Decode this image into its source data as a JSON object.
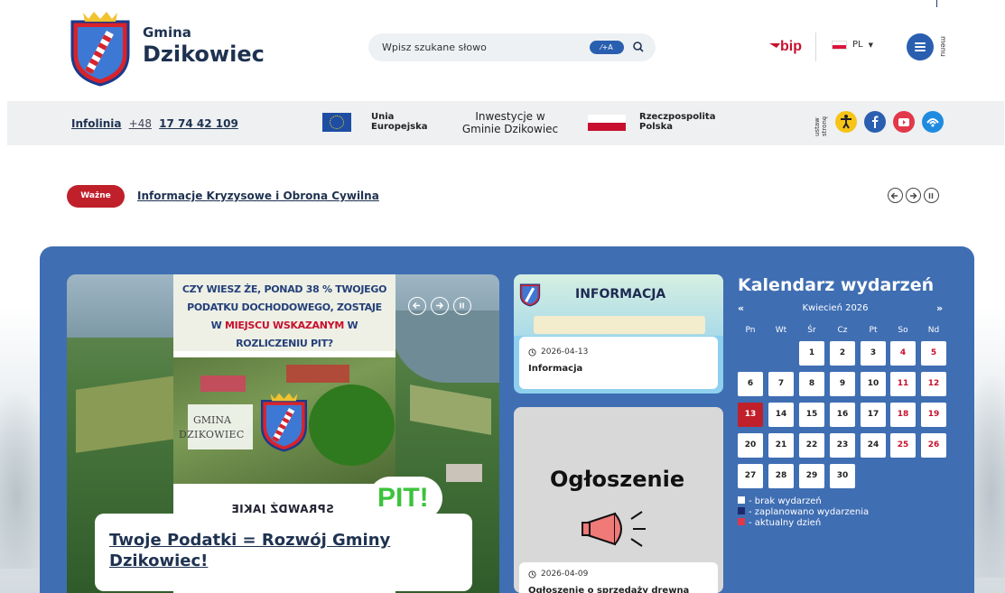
{
  "header": {
    "brand_small": "Gmina",
    "brand_name": "Dzikowiec",
    "search_placeholder": "Wpisz szukane słowo",
    "search_toggle": "⁄+A",
    "bip": "bip",
    "lang": "PL",
    "menu_label": "menu"
  },
  "infobar": {
    "infolinia_label": "Infolinia",
    "prefix": "+48",
    "number": "17 74 42 109",
    "eu_line1": "Unia",
    "eu_line2": "Europejska",
    "investment_line1": "Inwestycje w",
    "investment_line2": "Gminie Dzikowiec",
    "rp_line1": "Rzeczpospolita",
    "rp_line2": "Polska",
    "settings_line1": "ustaw",
    "settings_line2": "stronę"
  },
  "important": {
    "badge": "Ważne",
    "link": "Informacje Kryzysowe i Obrona Cywilna"
  },
  "slider": {
    "poster_line1": "CZY WIESZ ŻE, PONAD 38 % TWOJEGO",
    "poster_line2": "PODATKU DOCHODOWEGO, ZOSTAJE",
    "poster_line3_a": "W ",
    "poster_line3_red": "MIEJSCU WSKAZANYM",
    "poster_line3_b": " W",
    "poster_line4": "ROZLICZENIU PIT?",
    "gmina_word": "GMINA",
    "gmina_name": "DZIKOWIEC",
    "mirrored_text": "SPRAWDŹ JAKIE",
    "pit": "PIT!",
    "caption": "Twoje Podatki = Rozwój Gminy Dzikowiec!"
  },
  "cards": [
    {
      "header_title": "INFORMACJA",
      "date": "2026-04-13",
      "title": "Informacja"
    },
    {
      "header_title": "Ogłoszenie",
      "date": "2026-04-09",
      "title": "Ogłoszenie o sprzedaży drewna"
    }
  ],
  "calendar": {
    "title": "Kalendarz wydarzeń",
    "prev": "«",
    "next": "»",
    "month": "Kwiecień 2026",
    "weekdays": [
      "Pn",
      "Wt",
      "Śr",
      "Cz",
      "Pt",
      "So",
      "Nd"
    ],
    "days": [
      "1",
      "2",
      "3",
      "4",
      "5",
      "6",
      "7",
      "8",
      "9",
      "10",
      "11",
      "12",
      "13",
      "14",
      "15",
      "16",
      "17",
      "18",
      "19",
      "20",
      "21",
      "22",
      "23",
      "24",
      "25",
      "26",
      "27",
      "28",
      "29",
      "30"
    ],
    "first_weekday_index": 2,
    "today": "13",
    "legend": [
      {
        "label": "- brak wydarzeń",
        "color": "#ffffff"
      },
      {
        "label": "- zaplanowano wydarzenia",
        "color": "#1e2a6e"
      },
      {
        "label": "- aktualny dzień",
        "color": "#e0374a"
      }
    ]
  },
  "colors": {
    "panel": "#3f6eb3",
    "accent_red": "#c0202a",
    "brand_blue": "#2a5fb0"
  }
}
